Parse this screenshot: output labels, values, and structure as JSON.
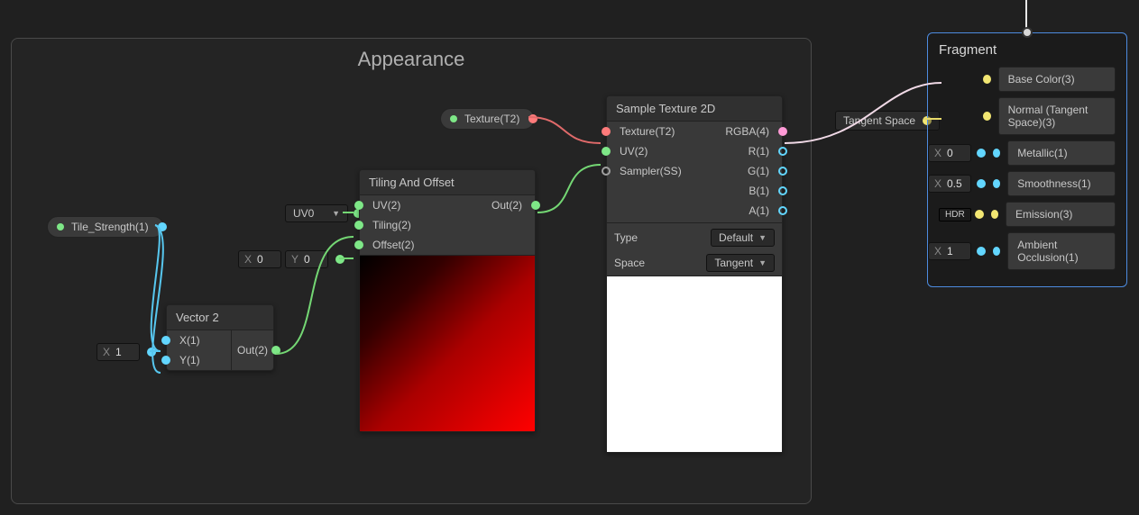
{
  "group": {
    "title": "Appearance"
  },
  "tile_strength": {
    "label": "Tile_Strength(1)"
  },
  "texture_prop": {
    "label": "Texture(T2)"
  },
  "x1": {
    "x_label": "X",
    "x_value": "1"
  },
  "offset": {
    "x_label": "X",
    "x_value": "0",
    "y_label": "Y",
    "y_value": "0"
  },
  "uvdd": {
    "value": "UV0"
  },
  "vector2": {
    "title": "Vector 2",
    "in_x": "X(1)",
    "in_y": "Y(1)",
    "out": "Out(2)"
  },
  "tiling": {
    "title": "Tiling And Offset",
    "in_uv": "UV(2)",
    "in_tiling": "Tiling(2)",
    "in_offset": "Offset(2)",
    "out": "Out(2)"
  },
  "sample": {
    "title": "Sample Texture 2D",
    "in_tex": "Texture(T2)",
    "in_uv": "UV(2)",
    "in_samp": "Sampler(SS)",
    "out_rgba": "RGBA(4)",
    "out_r": "R(1)",
    "out_g": "G(1)",
    "out_b": "B(1)",
    "out_a": "A(1)",
    "type_label": "Type",
    "type_value": "Default",
    "space_label": "Space",
    "space_value": "Tangent"
  },
  "tangent_chip": {
    "label": "Tangent Space"
  },
  "fragment": {
    "title": "Fragment",
    "base_color": "Base Color(3)",
    "normal": "Normal (Tangent Space)(3)",
    "metallic": "Metallic(1)",
    "smoothness": "Smoothness(1)",
    "emission": "Emission(3)",
    "ao": "Ambient Occlusion(1)",
    "metallic_pre": {
      "k": "X",
      "v": "0"
    },
    "smoothness_pre": {
      "k": "X",
      "v": "0.5"
    },
    "emission_pre": {
      "label": "HDR"
    },
    "ao_pre": {
      "k": "X",
      "v": "1"
    }
  }
}
